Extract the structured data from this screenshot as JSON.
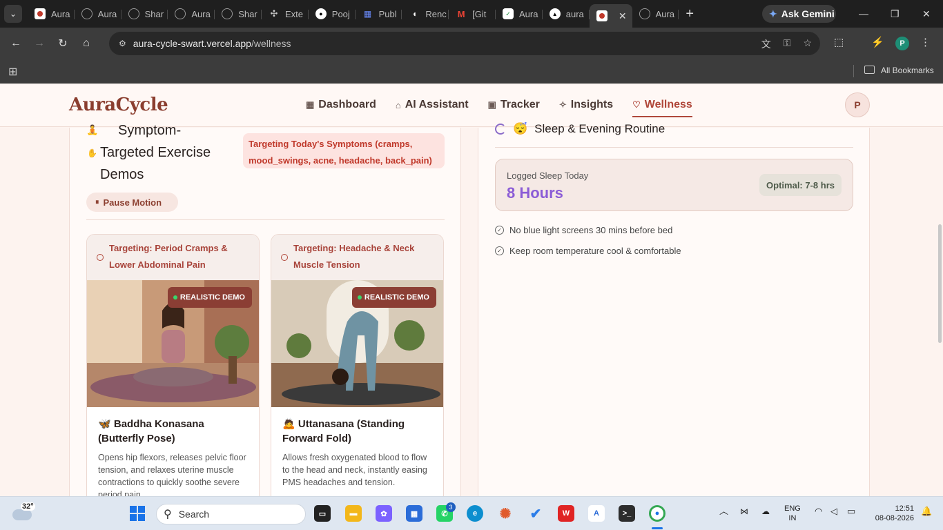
{
  "browser": {
    "tabs": [
      {
        "label": "Aura",
        "icon": "aura-favicon",
        "color": "#c0392b"
      },
      {
        "label": "Aura",
        "icon": "globe-icon",
        "color": "#777777"
      },
      {
        "label": "Shar",
        "icon": "globe-icon",
        "color": "#777777"
      },
      {
        "label": "Aura",
        "icon": "globe-icon",
        "color": "#777777"
      },
      {
        "label": "Shar",
        "icon": "globe-icon",
        "color": "#777777"
      },
      {
        "label": "Exte",
        "icon": "puzzle-icon",
        "color": "#aaaaaa"
      },
      {
        "label": "Pooj",
        "icon": "github-icon",
        "color": "#ffffff"
      },
      {
        "label": "Publ",
        "icon": "publish-icon",
        "color": "#4c6ef5"
      },
      {
        "label": "Renc",
        "icon": "render-icon",
        "color": "#ffffff"
      },
      {
        "label": "[Git",
        "icon": "gmail-icon",
        "color": "#d93025"
      },
      {
        "label": "Aura",
        "icon": "check-icon",
        "color": "#ffffff"
      },
      {
        "label": "aura",
        "icon": "vercel-icon",
        "color": "#ffffff"
      }
    ],
    "active_tab_label": "",
    "last_tab_label": "Aura",
    "ask_gemini": "Ask Gemini",
    "url_site": "aura-cycle-swart.vercel.app",
    "url_path": "/wellness",
    "all_bookmarks": "All Bookmarks",
    "profile_initial": "P"
  },
  "app": {
    "logo": "AuraCycle",
    "nav": [
      {
        "label": "Dashboard",
        "icon": "grid-icon"
      },
      {
        "label": "AI Assistant",
        "icon": "robot-icon"
      },
      {
        "label": "Tracker",
        "icon": "calendar-icon"
      },
      {
        "label": "Insights",
        "icon": "sparkle-icon"
      },
      {
        "label": "Wellness",
        "icon": "heart-icon",
        "active": true
      }
    ],
    "avatar_initial": "P"
  },
  "exercise_section": {
    "title_emoji": "🧘",
    "title": "Symptom-Targeted Exercise Demos",
    "targeting_badge": "Targeting Today's Symptoms (cramps, mood_swings, acne, headache, back_pain)",
    "pause_button": "Pause Motion",
    "cards": [
      {
        "targeting": "Targeting: Period Cramps & Lower Abdominal Pain",
        "demo_tag": "REALISTIC DEMO",
        "emoji": "🦋",
        "name": "Baddha Konasana (Butterfly Pose)",
        "description": "Opens hip flexors, releases pelvic floor tension, and relaxes uterine muscle contractions to quickly soothe severe period pain."
      },
      {
        "targeting": "Targeting: Headache & Neck Muscle Tension",
        "demo_tag": "REALISTIC DEMO",
        "emoji": "🙇",
        "name": "Uttanasana (Standing Forward Fold)",
        "description": "Allows fresh oxygenated blood to flow to the head and neck, instantly easing PMS headaches and tension."
      }
    ]
  },
  "sleep_section": {
    "emoji": "😴",
    "title": "Sleep & Evening Routine",
    "logged_label": "Logged Sleep Today",
    "logged_value": "8 Hours",
    "optimal": "Optimal: 7-8 hrs",
    "tips": [
      "No blue light screens 30 mins before bed",
      "Keep room temperature cool & comfortable"
    ]
  },
  "taskbar": {
    "temperature": "32°",
    "search_placeholder": "Search",
    "whatsapp_badge": "3",
    "lang_line1": "ENG",
    "lang_line2": "IN",
    "time": "12:51",
    "date": "08-08-2026"
  }
}
